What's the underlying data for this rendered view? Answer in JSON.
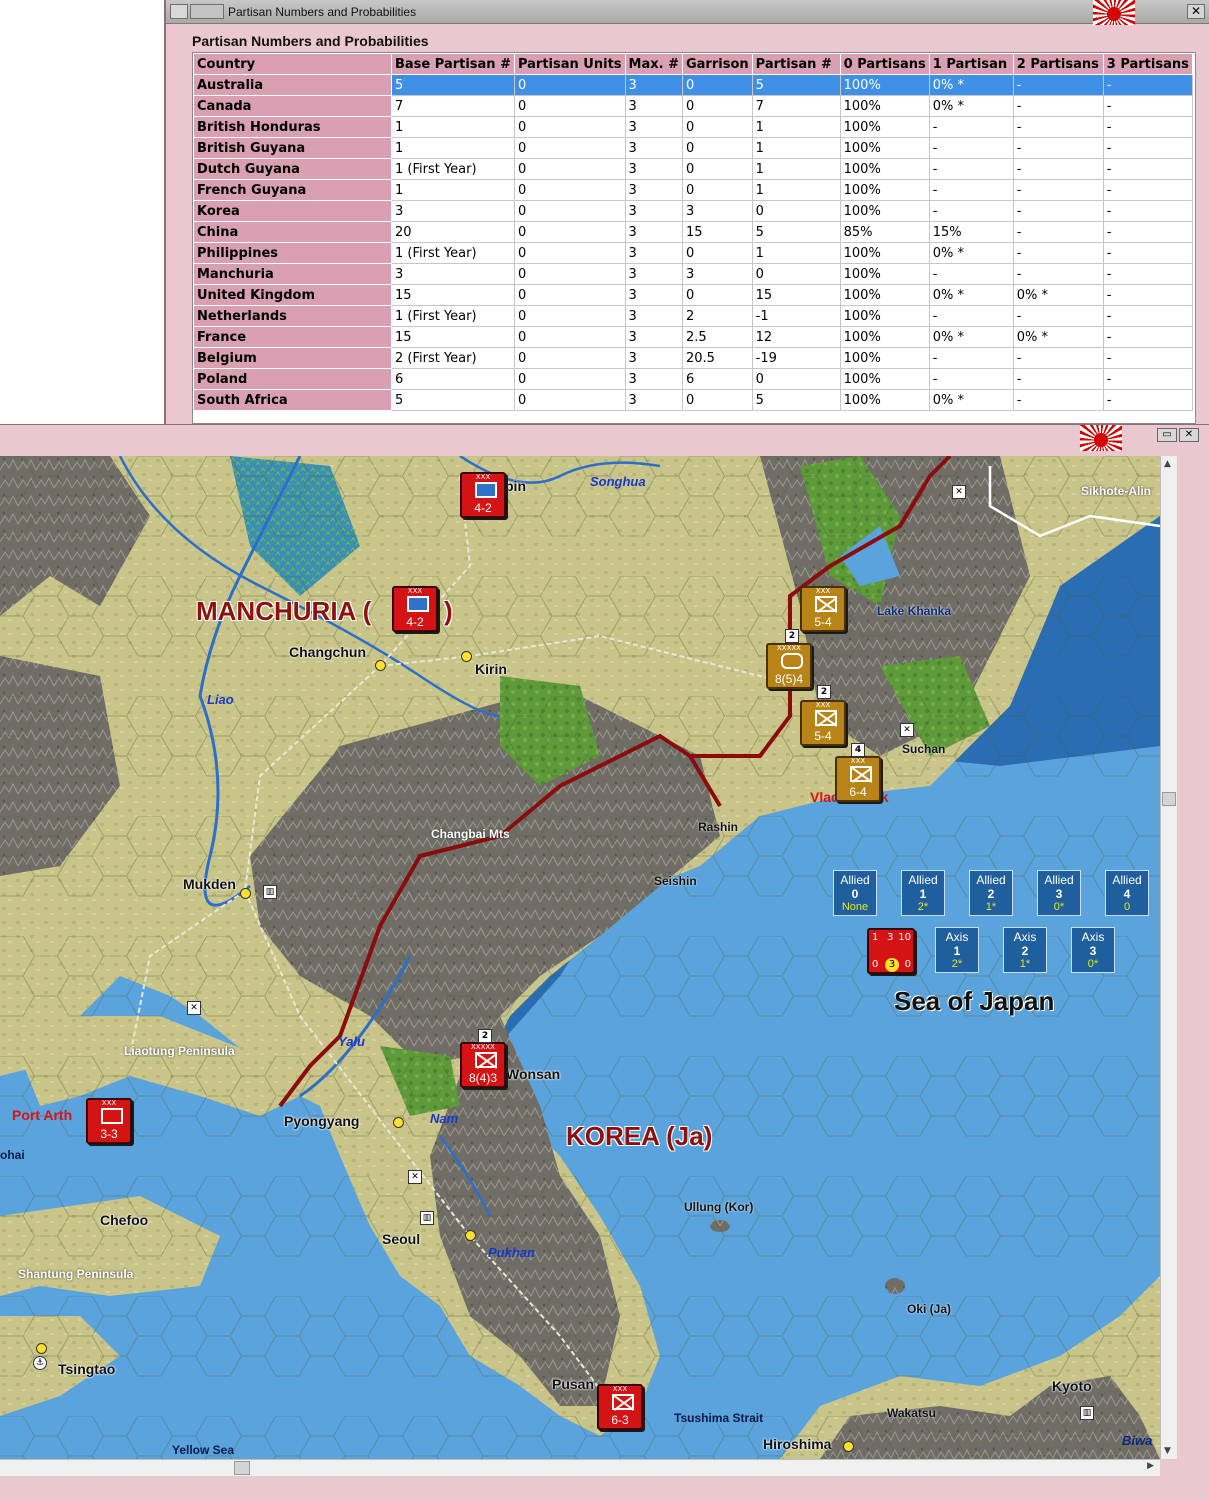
{
  "partisan_window": {
    "title": "Partisan Numbers and Probabilities",
    "heading": "Partisan Numbers and Probabilities",
    "close_label": "✕",
    "columns": [
      "Country",
      "Base Partisan #",
      "Partisan Units",
      "Max. #",
      "Garrison",
      "Partisan #",
      "0 Partisans",
      "1 Partisan",
      "2 Partisans",
      "3 Partisans"
    ],
    "rows": [
      [
        "Australia",
        "5",
        "0",
        "3",
        "0",
        "5",
        "100%",
        "0% *",
        "-",
        "-"
      ],
      [
        "Canada",
        "7",
        "0",
        "3",
        "0",
        "7",
        "100%",
        "0% *",
        "-",
        "-"
      ],
      [
        "British Honduras",
        "1",
        "0",
        "3",
        "0",
        "1",
        "100%",
        "-",
        "-",
        "-"
      ],
      [
        "British Guyana",
        "1",
        "0",
        "3",
        "0",
        "1",
        "100%",
        "-",
        "-",
        "-"
      ],
      [
        "Dutch Guyana",
        "1 (First Year)",
        "0",
        "3",
        "0",
        "1",
        "100%",
        "-",
        "-",
        "-"
      ],
      [
        "French Guyana",
        "1",
        "0",
        "3",
        "0",
        "1",
        "100%",
        "-",
        "-",
        "-"
      ],
      [
        "Korea",
        "3",
        "0",
        "3",
        "3",
        "0",
        "100%",
        "-",
        "-",
        "-"
      ],
      [
        "China",
        "20",
        "0",
        "3",
        "15",
        "5",
        "85%",
        "15%",
        "-",
        "-"
      ],
      [
        "Philippines",
        "1 (First Year)",
        "0",
        "3",
        "0",
        "1",
        "100%",
        "0% *",
        "-",
        "-"
      ],
      [
        "Manchuria",
        "3",
        "0",
        "3",
        "3",
        "0",
        "100%",
        "-",
        "-",
        "-"
      ],
      [
        "United Kingdom",
        "15",
        "0",
        "3",
        "0",
        "15",
        "100%",
        "0% *",
        "0% *",
        "-"
      ],
      [
        "Netherlands",
        "1 (First Year)",
        "0",
        "3",
        "2",
        "-1",
        "100%",
        "-",
        "-",
        "-"
      ],
      [
        "France",
        "15",
        "0",
        "3",
        "2.5",
        "12",
        "100%",
        "0% *",
        "0% *",
        "-"
      ],
      [
        "Belgium",
        "2 (First Year)",
        "0",
        "3",
        "20.5",
        "-19",
        "100%",
        "-",
        "-",
        "-"
      ],
      [
        "Poland",
        "6",
        "0",
        "3",
        "6",
        "0",
        "100%",
        "-",
        "-",
        "-"
      ],
      [
        "South Africa",
        "5",
        "0",
        "3",
        "0",
        "5",
        "100%",
        "0% *",
        "-",
        "-"
      ]
    ],
    "selected_row": 0
  },
  "map_window": {
    "buttons": [
      "▭",
      "✕"
    ],
    "region_labels": {
      "manchuria": "MANCHURIA (",
      "manchuria_paren": ")",
      "korea": "KOREA (Ja)",
      "sea_of_japan": "Sea of Japan"
    },
    "cities": {
      "harbin": "bin",
      "changchun": "Changchun",
      "kirin": "Kirin",
      "mukden": "Mukden",
      "pyongyang": "Pyongyang",
      "wonsan": "Wonsan",
      "seoul": "Seoul",
      "chefoo": "Chefoo",
      "tsingtao": "Tsingtao",
      "pusan": "Pusan",
      "hiroshima": "Hiroshima",
      "kyoto": "Kyoto",
      "vladivostok": "Vladivostok",
      "port_arthur": "Port Arth"
    },
    "small_labels": {
      "rashin": "Rashin",
      "seishin": "Seishin",
      "suchan": "Suchan",
      "lake_khanka": "Lake Khanka",
      "changbai": "Changbai Mts",
      "sikhote": "Sikhote-Alin",
      "liaotung": "Liaotung Peninsula",
      "shantung": "Shantung Peninsula",
      "ullung": "Ullung (Kor)",
      "oki": "Oki (Ja)",
      "wakatsu": "Wakatsu",
      "tsushima": "Tsushima Strait",
      "yellow_sea": "Yellow Sea",
      "chihli": "ohai"
    },
    "rivers": {
      "songhua": "Songhua",
      "liao": "Liao",
      "yalu": "Yalu",
      "nam": "Nam",
      "pukhan": "Pukhan",
      "biwa": "Biwa"
    },
    "counters": [
      {
        "id": "harbin-hq",
        "value": "4-2",
        "size": "XXX",
        "color": "red"
      },
      {
        "id": "manchuria-cav",
        "value": "4-2",
        "size": "XXX",
        "color": "red"
      },
      {
        "id": "sov-inf-1",
        "value": "5-4",
        "size": "XXX",
        "color": "gold"
      },
      {
        "id": "sov-armor",
        "value": "8(5)4",
        "size": "XXXXX",
        "color": "gold"
      },
      {
        "id": "sov-inf-2",
        "value": "5-4",
        "size": "XXX",
        "color": "gold"
      },
      {
        "id": "sov-inf-3",
        "value": "6-4",
        "size": "XXX",
        "color": "gold"
      },
      {
        "id": "wonsan-army",
        "value": "8(4)3",
        "size": "XXXXX",
        "color": "red"
      },
      {
        "id": "port-arthur",
        "value": "3-3",
        "size": "XXX",
        "color": "red"
      },
      {
        "id": "pusan-unit",
        "value": "6-3",
        "size": "XXX",
        "color": "red"
      }
    ],
    "stack_badges": {
      "b1": "2",
      "b2": "2",
      "b3": "4",
      "b4": "2"
    },
    "allied_boxes": [
      {
        "title": "Allied",
        "num": "0",
        "pct": "None"
      },
      {
        "title": "Allied",
        "num": "1",
        "pct": "2*"
      },
      {
        "title": "Allied",
        "num": "2",
        "pct": "1*"
      },
      {
        "title": "Allied",
        "num": "3",
        "pct": "0*"
      },
      {
        "title": "Allied",
        "num": "4",
        "pct": "0"
      }
    ],
    "axis_boxes": [
      {
        "title": "Axis",
        "num": "1",
        "pct": "2*"
      },
      {
        "title": "Axis",
        "num": "2",
        "pct": "1*"
      },
      {
        "title": "Axis",
        "num": "3",
        "pct": "0*"
      }
    ],
    "axis_marker": {
      "a": "1",
      "b": "3",
      "c": "10",
      "d": "0",
      "e": "3",
      "f": "0"
    },
    "colors": {
      "sea": "#2a6db3",
      "border": "#8a0c0c",
      "allied_box": "#1f5f9e",
      "axis_counter": "#d41414",
      "soviet_counter": "#b88418"
    }
  }
}
